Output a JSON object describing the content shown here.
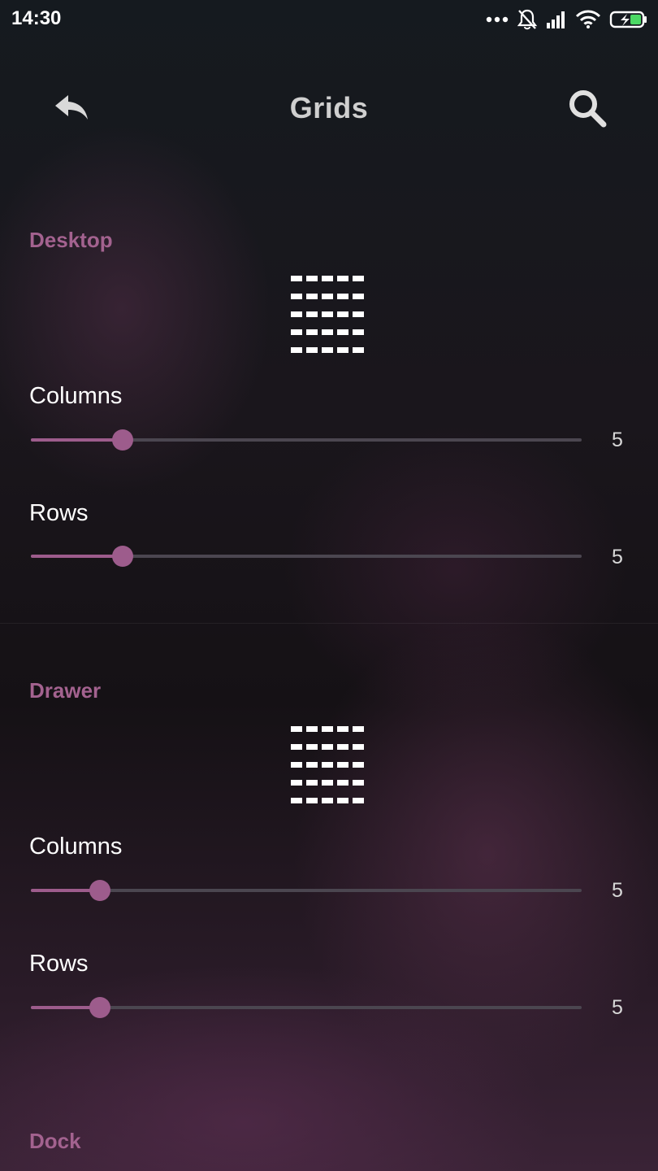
{
  "status_bar": {
    "time": "14:30",
    "icons": [
      "more-dots-icon",
      "notifications-off-icon",
      "signal-icon",
      "wifi-icon",
      "battery-charging-icon"
    ]
  },
  "header": {
    "title": "Grids",
    "back_icon": "back-arrow-icon",
    "search_icon": "search-icon"
  },
  "colors": {
    "accent": "#9d5c8c",
    "heading": "#a3628f",
    "track": "#4b4650"
  },
  "sections": {
    "desktop": {
      "heading": "Desktop",
      "preview": {
        "columns": 5,
        "rows": 5
      },
      "columns": {
        "label": "Columns",
        "value": "5",
        "slider_fraction": 0.167
      },
      "rows": {
        "label": "Rows",
        "value": "5",
        "slider_fraction": 0.167
      }
    },
    "drawer": {
      "heading": "Drawer",
      "preview": {
        "columns": 5,
        "rows": 5
      },
      "columns": {
        "label": "Columns",
        "value": "5",
        "slider_fraction": 0.125
      },
      "rows": {
        "label": "Rows",
        "value": "5",
        "slider_fraction": 0.125
      }
    },
    "dock": {
      "heading": "Dock"
    }
  }
}
